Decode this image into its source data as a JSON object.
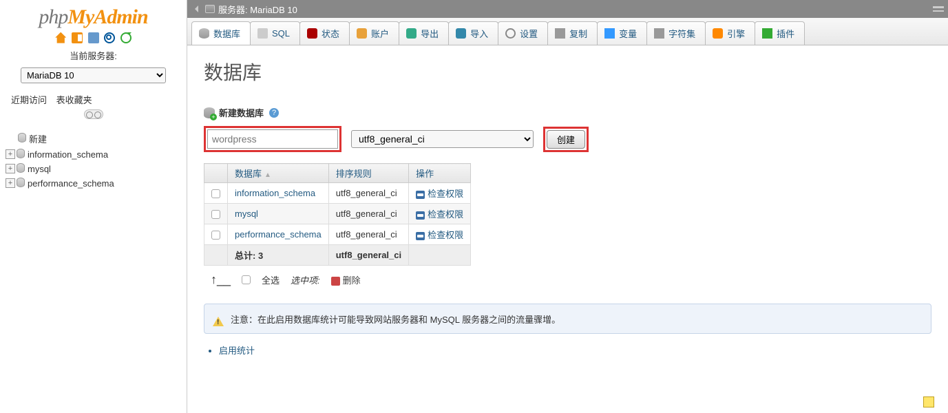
{
  "sidebar": {
    "current_server_label": "当前服务器:",
    "server_selected": "MariaDB 10",
    "side_tabs": {
      "recent": "近期访问",
      "favorites": "表收藏夹"
    },
    "new_label": "新建",
    "databases": [
      "information_schema",
      "mysql",
      "performance_schema"
    ]
  },
  "breadcrumb": {
    "server_label": "服务器: MariaDB 10"
  },
  "tabs": [
    {
      "key": "databases",
      "label": "数据库",
      "icon": "ti-db"
    },
    {
      "key": "sql",
      "label": "SQL",
      "icon": "ti-sql"
    },
    {
      "key": "status",
      "label": "状态",
      "icon": "ti-status"
    },
    {
      "key": "accounts",
      "label": "账户",
      "icon": "ti-user"
    },
    {
      "key": "export",
      "label": "导出",
      "icon": "ti-export"
    },
    {
      "key": "import",
      "label": "导入",
      "icon": "ti-import"
    },
    {
      "key": "settings",
      "label": "设置",
      "icon": "ti-settings"
    },
    {
      "key": "replication",
      "label": "复制",
      "icon": "ti-repl"
    },
    {
      "key": "variables",
      "label": "变量",
      "icon": "ti-var"
    },
    {
      "key": "charsets",
      "label": "字符集",
      "icon": "ti-charset"
    },
    {
      "key": "engines",
      "label": "引擎",
      "icon": "ti-engine"
    },
    {
      "key": "plugins",
      "label": "插件",
      "icon": "ti-plugin"
    }
  ],
  "page_title": "数据库",
  "create": {
    "heading": "新建数据库",
    "name_value": "wordpress",
    "collation_value": "utf8_general_ci",
    "button": "创建"
  },
  "table": {
    "headers": {
      "db": "数据库",
      "collation": "排序规则",
      "action": "操作"
    },
    "check_privileges": "检查权限",
    "rows": [
      {
        "name": "information_schema",
        "collation": "utf8_general_ci"
      },
      {
        "name": "mysql",
        "collation": "utf8_general_ci"
      },
      {
        "name": "performance_schema",
        "collation": "utf8_general_ci"
      }
    ],
    "total_label": "总计: 3",
    "total_collation": "utf8_general_ci"
  },
  "footer": {
    "select_all": "全选",
    "selected_label": "选中项:",
    "delete": "删除"
  },
  "notice": "注意：在此启用数据库统计可能导致网站服务器和 MySQL 服务器之间的流量骤增。",
  "enable_stats": "启用统计"
}
